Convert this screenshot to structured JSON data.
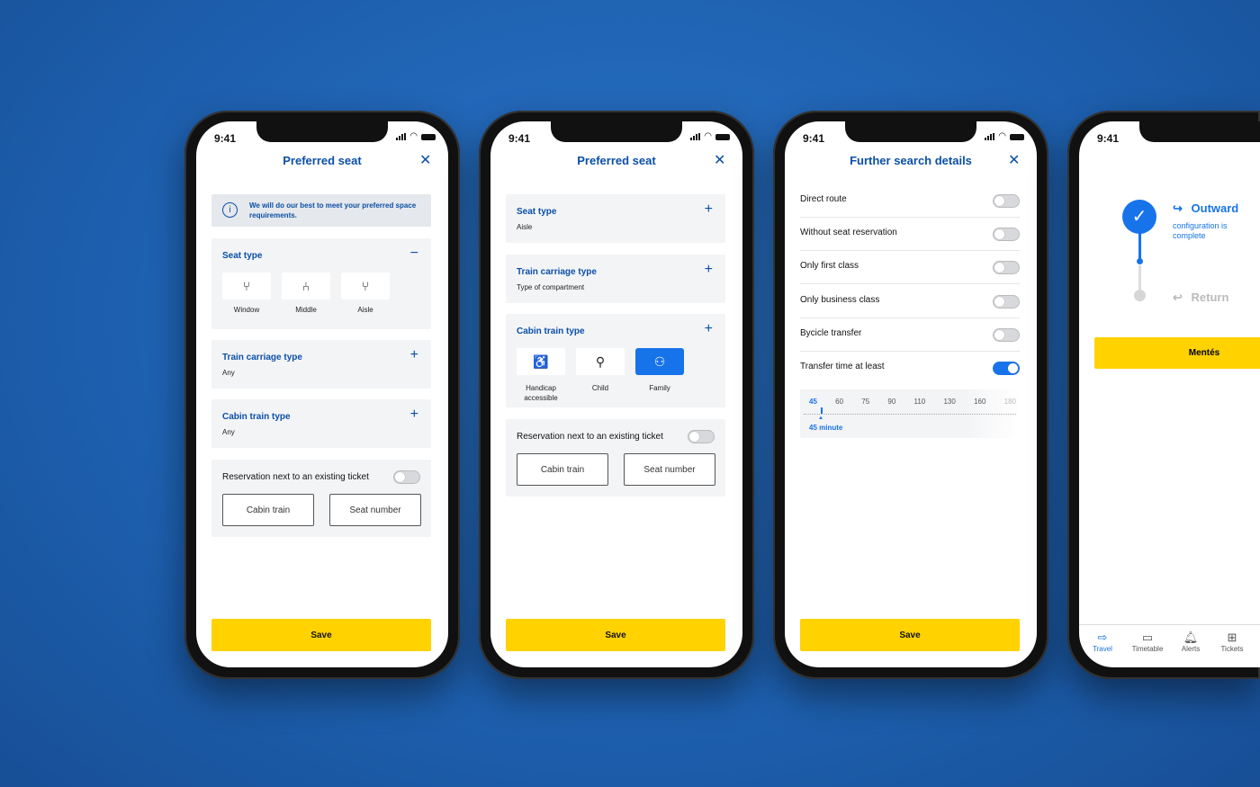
{
  "status": {
    "time": "9:41"
  },
  "colors": {
    "brand": "#0b4fa8",
    "accent": "#1773ea",
    "save": "#ffd200",
    "background": "#1d5fae"
  },
  "phone1": {
    "title": "Preferred seat",
    "info": "We will do our best to meet your preferred space requirements.",
    "seat_type": {
      "label": "Seat type",
      "options": [
        {
          "label": "Window",
          "icon": "window-seat-icon"
        },
        {
          "label": "Middle",
          "icon": "middle-seat-icon"
        },
        {
          "label": "Aisle",
          "icon": "aisle-seat-icon"
        }
      ]
    },
    "carriage": {
      "label": "Train carriage type",
      "value": "Any"
    },
    "cabin": {
      "label": "Cabin train type",
      "value": "Any"
    },
    "reservation": {
      "label": "Reservation next to an existing ticket",
      "enabled": false,
      "cabin_placeholder": "Cabin train",
      "seat_placeholder": "Seat number"
    },
    "save": "Save"
  },
  "phone2": {
    "title": "Preferred seat",
    "seat_type": {
      "label": "Seat type",
      "value": "Aisle"
    },
    "carriage": {
      "label": "Train carriage type",
      "value": "Type of compartment"
    },
    "cabin": {
      "label": "Cabin train type",
      "options": [
        {
          "label": "Handicap accessible",
          "icon": "wheelchair-icon"
        },
        {
          "label": "Child",
          "icon": "child-icon"
        },
        {
          "label": "Family",
          "icon": "family-icon",
          "selected": true
        }
      ]
    },
    "reservation": {
      "label": "Reservation next to an existing ticket",
      "enabled": false,
      "cabin_placeholder": "Cabin train",
      "seat_placeholder": "Seat number"
    },
    "save": "Save"
  },
  "phone3": {
    "title": "Further search details",
    "options": [
      {
        "label": "Direct route",
        "on": false
      },
      {
        "label": "Without seat reservation",
        "on": false
      },
      {
        "label": "Only first class",
        "on": false
      },
      {
        "label": "Only business class",
        "on": false
      },
      {
        "label": "Bycicle transfer",
        "on": false
      },
      {
        "label": "Transfer time at least",
        "on": true
      }
    ],
    "slider": {
      "ticks": [
        "45",
        "60",
        "75",
        "90",
        "110",
        "130",
        "160",
        "180"
      ],
      "value": "45",
      "value_label": "45 minute"
    },
    "save": "Save"
  },
  "phone4": {
    "outward": {
      "label": "Outward",
      "sub": "configuration is complete",
      "done": true
    },
    "return": {
      "label": "Return",
      "done": false
    },
    "button": "Mentés",
    "tabs": [
      {
        "label": "Travel",
        "icon": "signpost-icon",
        "active": true
      },
      {
        "label": "Timetable",
        "icon": "calendar-icon"
      },
      {
        "label": "Alerts",
        "icon": "bell-icon"
      },
      {
        "label": "Tickets",
        "icon": "qr-icon"
      }
    ]
  }
}
